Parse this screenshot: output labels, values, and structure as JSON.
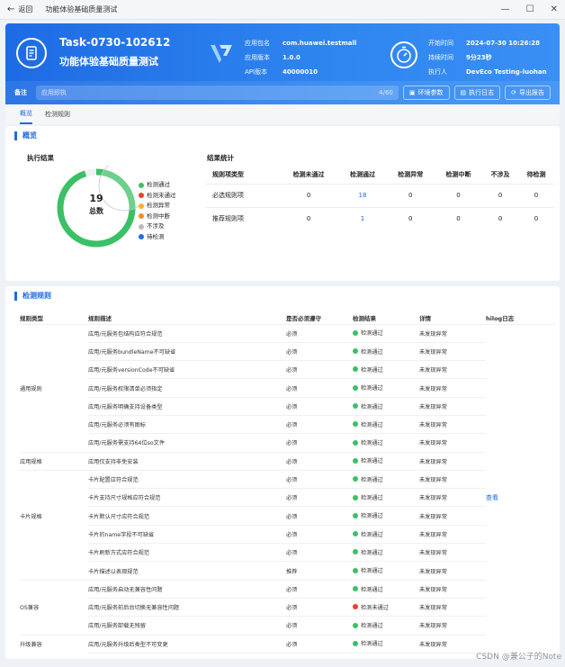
{
  "window": {
    "back_label": "返回",
    "title": "功能体验基础质量测试"
  },
  "task": {
    "id": "Task-0730-102612",
    "name": "功能体验基础质量测试"
  },
  "app_info": {
    "package_label": "应用包名",
    "package_value": "com.huawei.testmall",
    "version_label": "应用版本",
    "version_value": "1.0.0",
    "api_label": "API版本",
    "api_value": "40000010"
  },
  "run_info": {
    "start_label": "开始时间",
    "start_value": "2024-07-30 10:26:28",
    "duration_label": "持续时间",
    "duration_value": "9分23秒",
    "executor_label": "执行人",
    "executor_value": "DevEco Testing-luohan"
  },
  "notes": {
    "label": "备注",
    "placeholder": "应用即执",
    "counter": "4/60",
    "buttons": [
      "环境参数",
      "执行日志",
      "导出报告"
    ]
  },
  "tabs": [
    "概览",
    "检测规则"
  ],
  "overview": {
    "section_title": "概览",
    "exec_title": "执行结果",
    "total_num": "19",
    "total_label": "总数",
    "legend": [
      {
        "label": "检测通过",
        "color": "#3cc066"
      },
      {
        "label": "检测未通过",
        "color": "#e8412f"
      },
      {
        "label": "检测异常",
        "color": "#f5b324"
      },
      {
        "label": "检测中断",
        "color": "#f08c28"
      },
      {
        "label": "不涉及",
        "color": "#b8bcc2"
      },
      {
        "label": "待检测",
        "color": "#1e6be4"
      }
    ],
    "donut_share": 0.95,
    "stats_title": "结果统计",
    "stats_headers": [
      "规则项类型",
      "检测未通过",
      "检测通过",
      "检测异常",
      "检测中断",
      "不涉及",
      "待检测"
    ],
    "stats_rows": [
      [
        "必选规则项",
        "0",
        "18",
        "0",
        "0",
        "0",
        "0"
      ],
      [
        "推荐规则项",
        "0",
        "1",
        "0",
        "0",
        "0",
        "0"
      ]
    ]
  },
  "rules": {
    "section_title": "检测规则",
    "headers": [
      "规则类型",
      "规则描述",
      "是否必须遵守",
      "检测结果",
      "详情",
      "hilog日志"
    ],
    "view_label": "查看",
    "rows": [
      {
        "cat": "",
        "desc": "应用/元服务包结构应符合规范",
        "req": "必须",
        "result": "检测通过",
        "color": "#3cc066",
        "detail": "未发现异常"
      },
      {
        "cat": "",
        "desc": "应用/元服务bundleName不可缺省",
        "req": "必须",
        "result": "检测通过",
        "color": "#3cc066",
        "detail": "未发现异常"
      },
      {
        "cat": "",
        "desc": "应用/元服务versionCode不可缺省",
        "req": "必须",
        "result": "检测通过",
        "color": "#3cc066",
        "detail": "未发现异常"
      },
      {
        "cat": "通用规则",
        "desc": "应用/元服务权限清单必须指定",
        "req": "必须",
        "result": "检测通过",
        "color": "#3cc066",
        "detail": "未发现异常"
      },
      {
        "cat": "",
        "desc": "应用/元服务明确支持设备类型",
        "req": "必须",
        "result": "检测通过",
        "color": "#3cc066",
        "detail": "未发现异常"
      },
      {
        "cat": "",
        "desc": "应用/元服务必须有图标",
        "req": "必须",
        "result": "检测通过",
        "color": "#3cc066",
        "detail": "未发现异常"
      },
      {
        "cat": "",
        "desc": "应用/元服务需支持64位so文件",
        "req": "必须",
        "result": "检测通过",
        "color": "#3cc066",
        "detail": "未发现异常"
      },
      {
        "cat": "应用规格",
        "desc": "应用仅支持非免安装",
        "req": "必须",
        "result": "检测通过",
        "color": "#3cc066",
        "detail": "未发现异常"
      },
      {
        "cat": "",
        "desc": "卡片配置应符合规范",
        "req": "必须",
        "result": "检测通过",
        "color": "#3cc066",
        "detail": "未发现异常"
      },
      {
        "cat": "",
        "desc": "卡片支持尺寸规格应符合规范",
        "req": "必须",
        "result": "检测通过",
        "color": "#3cc066",
        "detail": "未发现异常"
      },
      {
        "cat": "卡片规格",
        "desc": "卡片默认尺寸应符合规范",
        "req": "必须",
        "result": "检测通过",
        "color": "#3cc066",
        "detail": "未发现异常"
      },
      {
        "cat": "",
        "desc": "卡片的name字段不可缺省",
        "req": "必须",
        "result": "检测通过",
        "color": "#3cc066",
        "detail": "未发现异常"
      },
      {
        "cat": "",
        "desc": "卡片刷新方式应符合规范",
        "req": "必须",
        "result": "检测通过",
        "color": "#3cc066",
        "detail": "未发现异常"
      },
      {
        "cat": "",
        "desc": "卡片描述以表观规范",
        "req": "推荐",
        "result": "检测通过",
        "color": "#3cc066",
        "detail": "未发现异常"
      },
      {
        "cat": "",
        "desc": "应用/元服务启动无兼容性问题",
        "req": "必须",
        "result": "检测通过",
        "color": "#3cc066",
        "detail": "未发现异常"
      },
      {
        "cat": "OS兼容",
        "desc": "应用/元服务前后台切换无兼容性问题",
        "req": "必须",
        "result": "检测未通过",
        "color": "#e8412f",
        "detail": "未发现异常"
      },
      {
        "cat": "",
        "desc": "应用/元服务卸载无残留",
        "req": "必须",
        "result": "检测通过",
        "color": "#3cc066",
        "detail": "未发现异常"
      },
      {
        "cat": "升级兼容",
        "desc": "应用/元服务升级后类型不可变更",
        "req": "必须",
        "result": "检测通过",
        "color": "#3cc066",
        "detail": "未发现异常"
      },
      {
        "cat": "",
        "desc": "应用/元服务升级无兼容性问题",
        "req": "必须",
        "result": "检测通过",
        "color": "#3cc066",
        "detail": "未发现异常"
      }
    ]
  },
  "watermark": "CSDN @兼公子的Note"
}
